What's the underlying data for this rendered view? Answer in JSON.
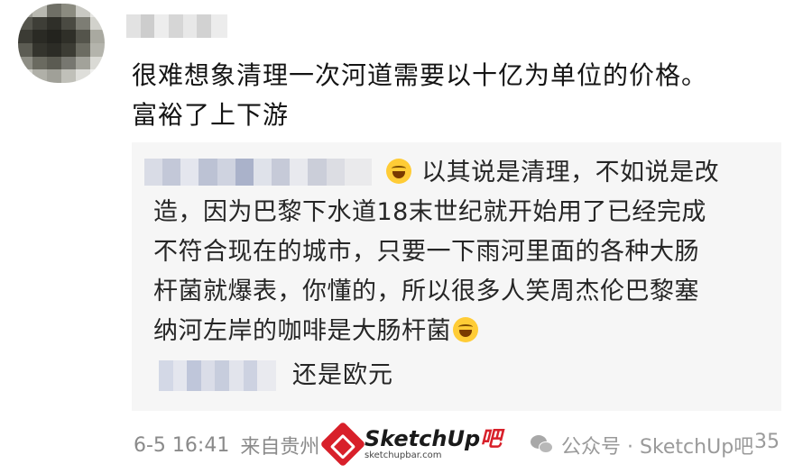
{
  "comment": {
    "author_avatar": "pixelated-avatar",
    "author_name": "",
    "text_line1": "很难想象清理一次河道需要以十亿为单位的价格。",
    "text_line2": "富裕了上下游"
  },
  "reply": {
    "author_name": "",
    "line1": "以其说是清理，不如说是改",
    "line2": "造，因为巴黎下水道18末世纪就开始用了已经完成",
    "line3": "不符合现在的城市，只要一下雨河里面的各种大肠",
    "line4": "杆菌就爆表，你懂的，所以很多人笑周杰伦巴黎塞",
    "line5": "纳河左岸的咖啡是大肠杆菌",
    "emoji": "laughing-tears-emoji"
  },
  "sub_reply": {
    "author_name": "",
    "text": "还是欧元"
  },
  "meta": {
    "date": "6-5 16:41",
    "location": "来自贵州"
  },
  "watermark": {
    "logo_name_main": "SketchUp",
    "logo_name_accent": "吧",
    "logo_url": "sketchupbar.com",
    "wechat_text": "公众号 · SketchUp吧"
  },
  "likes": {
    "count": "35"
  },
  "colors": {
    "text": "#141414",
    "muted": "#8a8a8a",
    "card_bg": "#f6f6f6",
    "brand_red": "#d8202a"
  }
}
